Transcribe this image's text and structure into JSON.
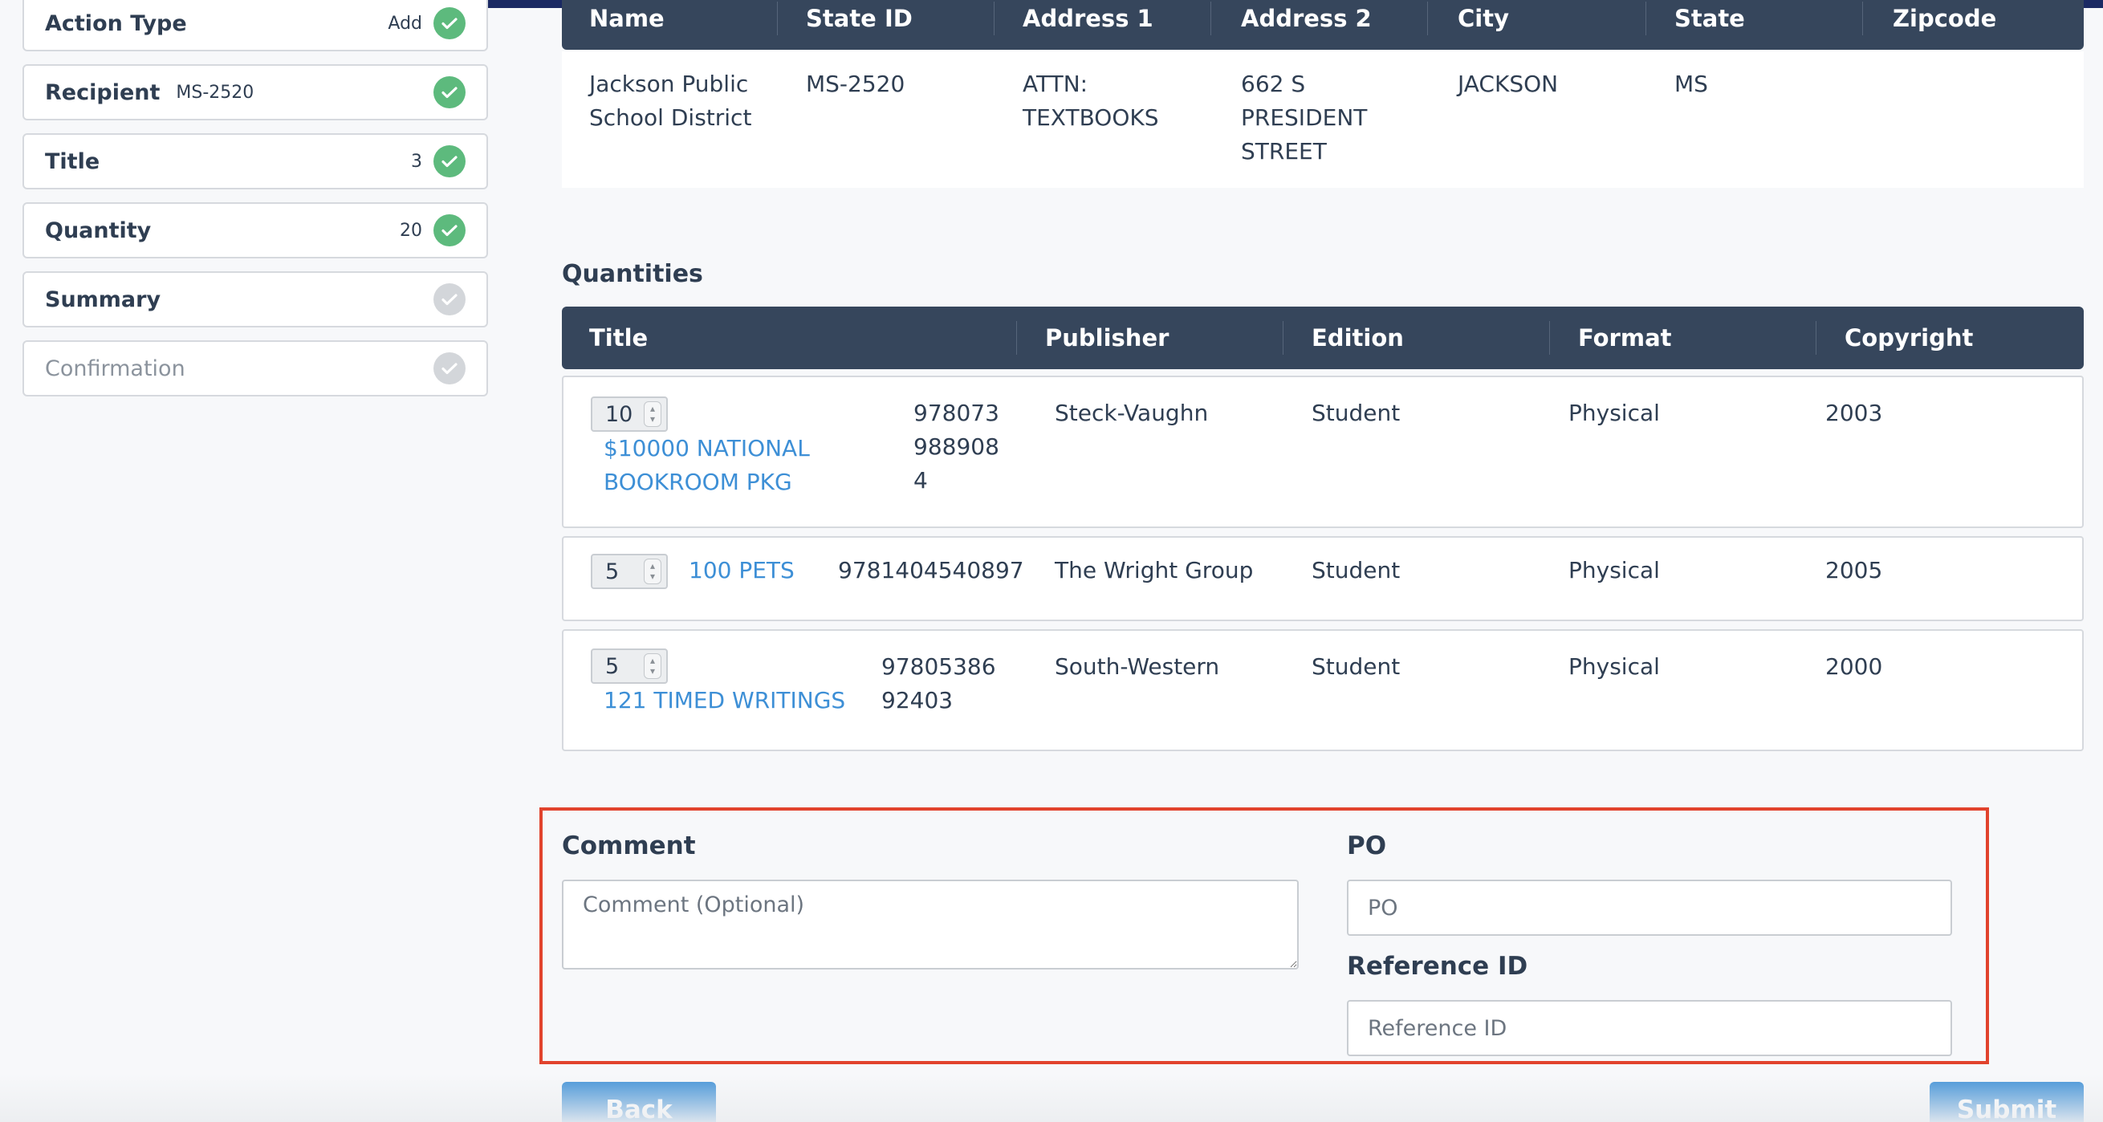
{
  "steps": [
    {
      "label": "Action Type",
      "value": "Add",
      "status": "done"
    },
    {
      "label": "Recipient",
      "inline_value": "MS-2520",
      "status": "done"
    },
    {
      "label": "Title",
      "value": "3",
      "status": "done"
    },
    {
      "label": "Quantity",
      "value": "20",
      "status": "done"
    },
    {
      "label": "Summary",
      "status": "pending"
    },
    {
      "label": "Confirmation",
      "status": "pending"
    }
  ],
  "recipient_table": {
    "headers": [
      "Name",
      "State ID",
      "Address 1",
      "Address 2",
      "City",
      "State",
      "Zipcode"
    ],
    "row": {
      "name": "Jackson Public School District",
      "state_id": "MS-2520",
      "address1": "ATTN: TEXTBOOKS",
      "address2": "662 S PRESIDENT STREET",
      "city": "JACKSON",
      "state": "MS",
      "zipcode": ""
    }
  },
  "quantities": {
    "title": "Quantities",
    "headers": [
      "Title",
      "Publisher",
      "Edition",
      "Format",
      "Copyright"
    ],
    "rows": [
      {
        "qty": "10",
        "title": "$10000 NATIONAL BOOKROOM PKG",
        "isbn": "9780739889084",
        "publisher": "Steck-Vaughn",
        "edition": "Student",
        "format": "Physical",
        "copyright": "2003"
      },
      {
        "qty": "5",
        "title": "100 PETS",
        "isbn": "9781404540897",
        "publisher": "The Wright Group",
        "edition": "Student",
        "format": "Physical",
        "copyright": "2005"
      },
      {
        "qty": "5",
        "title": "121 TIMED WRITINGS",
        "isbn": "9780538692403",
        "publisher": "South-Western",
        "edition": "Student",
        "format": "Physical",
        "copyright": "2000"
      }
    ]
  },
  "form": {
    "comment_label": "Comment",
    "comment_placeholder": "Comment (Optional)",
    "po_label": "PO",
    "po_placeholder": "PO",
    "reference_label": "Reference ID",
    "reference_placeholder": "Reference ID"
  },
  "buttons": {
    "back": "Back",
    "submit": "Submit"
  },
  "colors": {
    "header_bg": "#36465c",
    "accent": "#3d8fd6",
    "done": "#5dba7d",
    "pending": "#d3d6da",
    "highlight": "#e1432d",
    "topbar": "#1b2a63"
  }
}
